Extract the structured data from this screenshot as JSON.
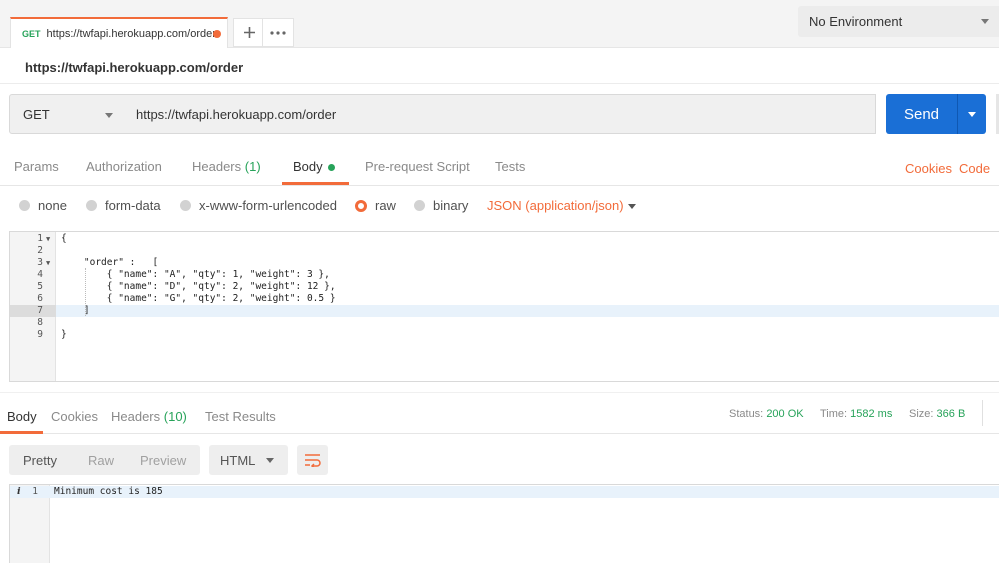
{
  "tab": {
    "method": "GET",
    "url": "https://twfapi.herokuapp.com/order"
  },
  "environment": {
    "selected": "No Environment"
  },
  "title": "https://twfapi.herokuapp.com/order",
  "request": {
    "method": "GET",
    "url": "https://twfapi.herokuapp.com/order",
    "send_label": "Send"
  },
  "req_tabs": {
    "params": "Params",
    "authorization": "Authorization",
    "headers": "Headers",
    "headers_count": "(1)",
    "body": "Body",
    "prerequest": "Pre-request Script",
    "tests": "Tests",
    "cookies": "Cookies",
    "code": "Code"
  },
  "body_types": {
    "none": "none",
    "form_data": "form-data",
    "urlencoded": "x-www-form-urlencoded",
    "raw": "raw",
    "binary": "binary",
    "format": "JSON (application/json)"
  },
  "editor": {
    "lines": [
      {
        "num": "1",
        "text": "{"
      },
      {
        "num": "2",
        "text": ""
      },
      {
        "num": "3",
        "text": "    \"order\" :   ["
      },
      {
        "num": "4",
        "text": "        { \"name\": \"A\", \"qty\": 1, \"weight\": 3 },"
      },
      {
        "num": "5",
        "text": "        { \"name\": \"D\", \"qty\": 2, \"weight\": 12 },"
      },
      {
        "num": "6",
        "text": "        { \"name\": \"G\", \"qty\": 2, \"weight\": 0.5 }"
      },
      {
        "num": "7",
        "text": "    ]"
      },
      {
        "num": "8",
        "text": ""
      },
      {
        "num": "9",
        "text": "}"
      }
    ]
  },
  "response": {
    "tabs": {
      "body": "Body",
      "cookies": "Cookies",
      "headers": "Headers",
      "headers_count": "(10)",
      "test_results": "Test Results"
    },
    "status_label": "Status:",
    "status": "200 OK",
    "time_label": "Time:",
    "time": "1582 ms",
    "size_label": "Size:",
    "size": "366 B",
    "views": {
      "pretty": "Pretty",
      "raw": "Raw",
      "preview": "Preview"
    },
    "format": "HTML",
    "line_num": "1",
    "line_text": "Minimum cost is 185"
  },
  "colors": {
    "accent": "#f26b3a",
    "send": "#1a6fd6",
    "success": "#27a35a"
  }
}
